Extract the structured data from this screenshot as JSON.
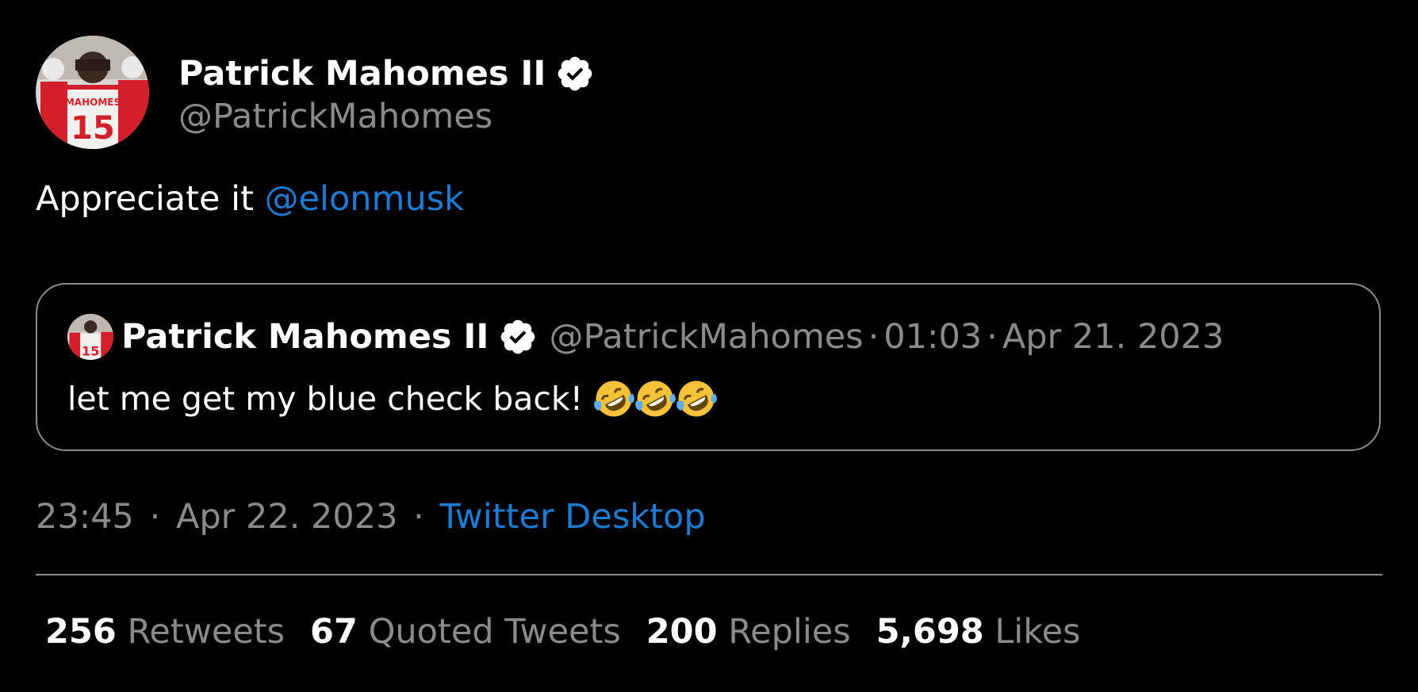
{
  "tweet": {
    "author": {
      "display_name": "Patrick Mahomes II",
      "handle": "@PatrickMahomes",
      "verified_icon": "verified-badge-icon",
      "avatar_jersey_name": "MAHOMES",
      "avatar_jersey_number": "15"
    },
    "text": "Appreciate it ",
    "mention": "@elonmusk",
    "quoted": {
      "display_name": "Patrick Mahomes II",
      "handle": "@PatrickMahomes",
      "time": "01:03",
      "date": "Apr 21. 2023",
      "text": "let me get my blue check back!",
      "emoji": [
        "rofl-emoji",
        "rofl-emoji",
        "rofl-emoji"
      ]
    },
    "time": "23:45",
    "date": "Apr 22. 2023",
    "source": "Twitter Desktop",
    "separator": "·",
    "stats": [
      {
        "value": "256",
        "label": "Retweets"
      },
      {
        "value": "67",
        "label": "Quoted Tweets"
      },
      {
        "value": "200",
        "label": "Replies"
      },
      {
        "value": "5,698",
        "label": "Likes"
      }
    ]
  },
  "colors": {
    "background": "#000000",
    "text": "#ffffff",
    "muted": "#8b8b8b",
    "link": "#1d7bd1",
    "jersey_red": "#d31f2b"
  }
}
